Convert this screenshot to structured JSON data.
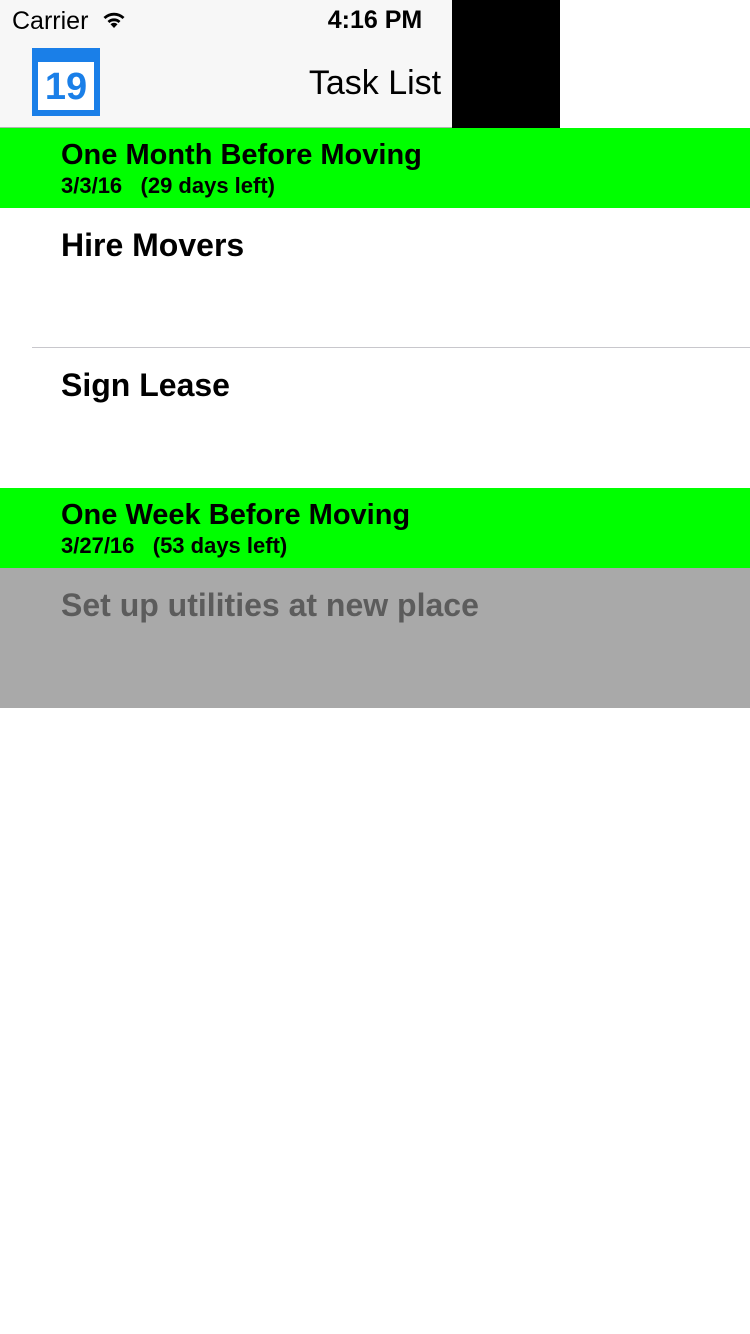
{
  "status_bar": {
    "carrier": "Carrier",
    "time": "4:16 PM",
    "wifi_icon": "wifi-icon",
    "battery_icon": "battery-icon"
  },
  "nav": {
    "title": "Task List",
    "calendar_icon": "calendar-icon",
    "calendar_day": "19"
  },
  "sections": [
    {
      "title": "One Month Before Moving",
      "date": "3/3/16   (29 days left)",
      "tasks": [
        {
          "title": "Hire Movers",
          "completed": false
        },
        {
          "title": "Sign Lease",
          "completed": false
        }
      ]
    },
    {
      "title": "One Week Before Moving",
      "date": "3/27/16   (53 days left)",
      "tasks": [
        {
          "title": "Set up utilities at new place",
          "completed": true
        }
      ]
    }
  ],
  "colors": {
    "section_header_bg": "#00ff00",
    "completed_row_bg": "#a9a9a9",
    "completed_text": "#5c5c5c",
    "accent": "#1a7fe8"
  }
}
